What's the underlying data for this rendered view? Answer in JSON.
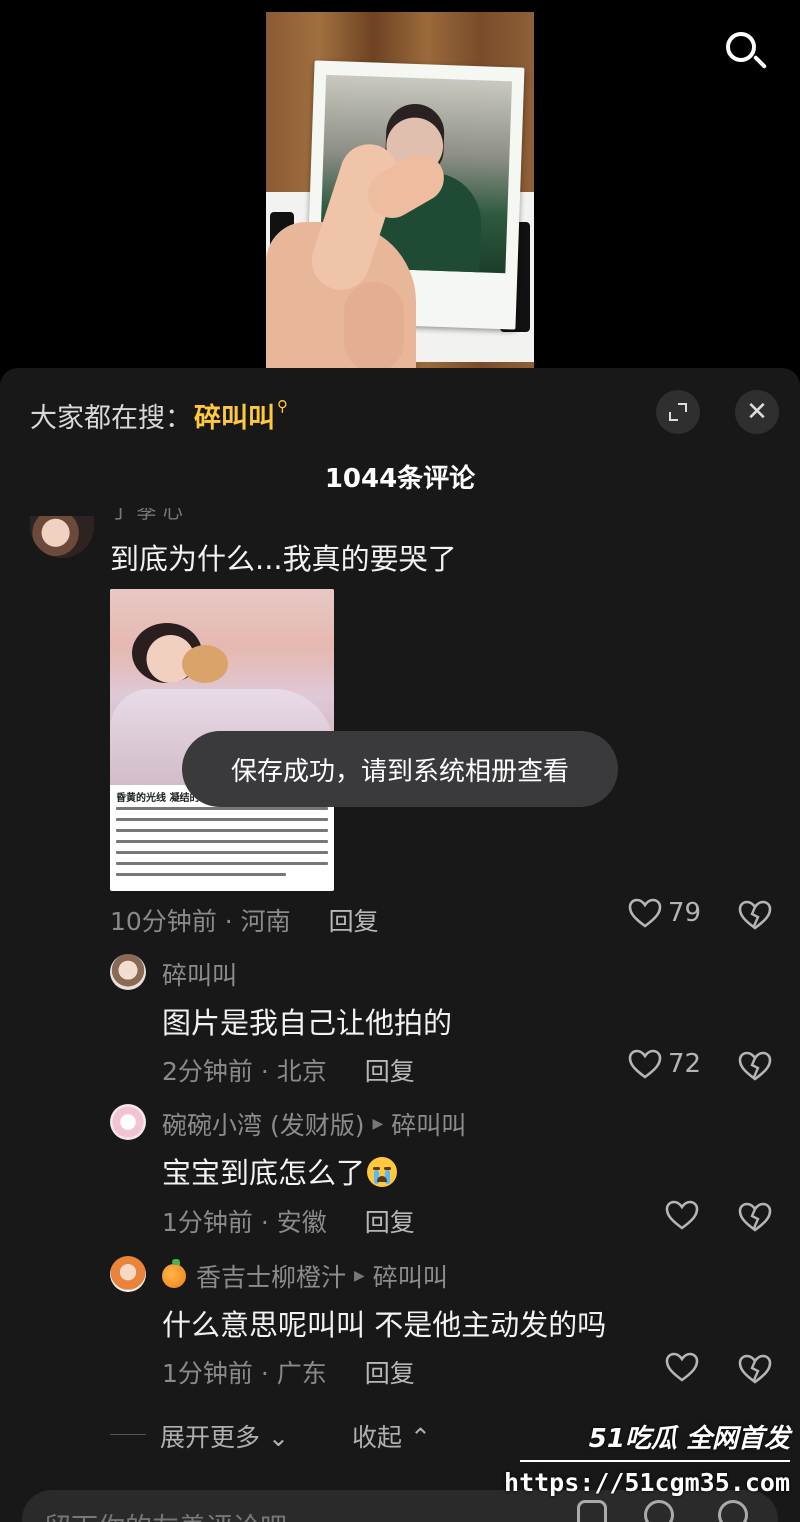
{
  "sheet": {
    "hot_search": {
      "prefix": "大家都在搜：",
      "keyword": "碎叫叫"
    },
    "comment_count_title": "1044条评论"
  },
  "main_comment": {
    "text": "到底为什么...我真的要哭了",
    "image_caption_title": "昏黄的光线 凝结的",
    "time_location": "10分钟前 · 河南",
    "reply_label": "回复",
    "likes": "79"
  },
  "replies": [
    {
      "author": "碎叫叫",
      "reply_to": "",
      "text": "图片是我自己让他拍的",
      "time_location": "2分钟前 · 北京",
      "reply_label": "回复",
      "likes": "72"
    },
    {
      "author": "碗碗小湾 (发财版)",
      "reply_to": "碎叫叫",
      "text": "宝宝到底怎么了",
      "time_location": "1分钟前 · 安徽",
      "reply_label": "回复",
      "likes": ""
    },
    {
      "author": "香吉士柳橙汁",
      "reply_to": "碎叫叫",
      "text": "什么意思呢叫叫  不是他主动发的吗",
      "time_location": "1分钟前 · 广东",
      "reply_label": "回复",
      "likes": ""
    }
  ],
  "thread_controls": {
    "expand_more": "展开更多",
    "collapse": "收起"
  },
  "toast": "保存成功，请到系统相册查看",
  "input": {
    "placeholder": "留下你的友善评论吧"
  },
  "watermark": {
    "brand": "51吃瓜 全网首发",
    "url": "https://51cgm35.com"
  },
  "colors": {
    "accent_keyword": "#ffc83d",
    "sheet_bg": "#181818"
  },
  "icons": [
    "search-icon",
    "expand-icon",
    "close-icon",
    "heart-icon",
    "dislike-icon",
    "image-icon",
    "at-icon",
    "emoji-icon"
  ]
}
